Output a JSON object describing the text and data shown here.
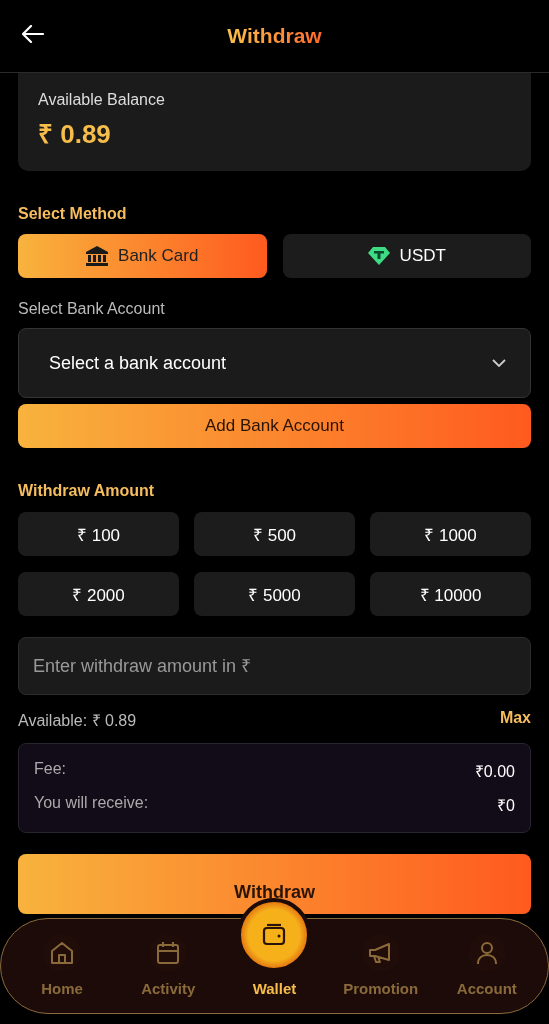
{
  "header": {
    "title": "Withdraw"
  },
  "balance": {
    "label": "Available Balance",
    "amount": "₹ 0.89"
  },
  "method_section": {
    "title": "Select Method"
  },
  "methods": [
    {
      "label": "Bank Card",
      "kind": "bank",
      "selected": true
    },
    {
      "label": "USDT",
      "kind": "usdt",
      "selected": false
    }
  ],
  "bank_account": {
    "label": "Select Bank Account",
    "value": "Select a bank account",
    "add_button": "Add Bank Account"
  },
  "amount_section": {
    "title": "Withdraw Amount"
  },
  "amounts": [
    "₹ 100",
    "₹ 500",
    "₹ 1000",
    "₹ 2000",
    "₹ 5000",
    "₹ 10000"
  ],
  "amount_input": {
    "placeholder": "Enter withdraw amount in ₹"
  },
  "available": {
    "text": "Available: ₹ 0.89",
    "max": "Max"
  },
  "summary": [
    {
      "label": "Fee:",
      "value": "₹0.00"
    },
    {
      "label": "You will receive:",
      "value": "₹0"
    }
  ],
  "submit": "Withdraw",
  "nav": [
    {
      "label": "Home",
      "kind": "home",
      "selected": false
    },
    {
      "label": "Activity",
      "kind": "calendar",
      "selected": false
    },
    {
      "label": "Wallet",
      "kind": "wallet",
      "selected": true
    },
    {
      "label": "Promotion",
      "kind": "megaphone",
      "selected": false
    },
    {
      "label": "Account",
      "kind": "person",
      "selected": false
    }
  ]
}
